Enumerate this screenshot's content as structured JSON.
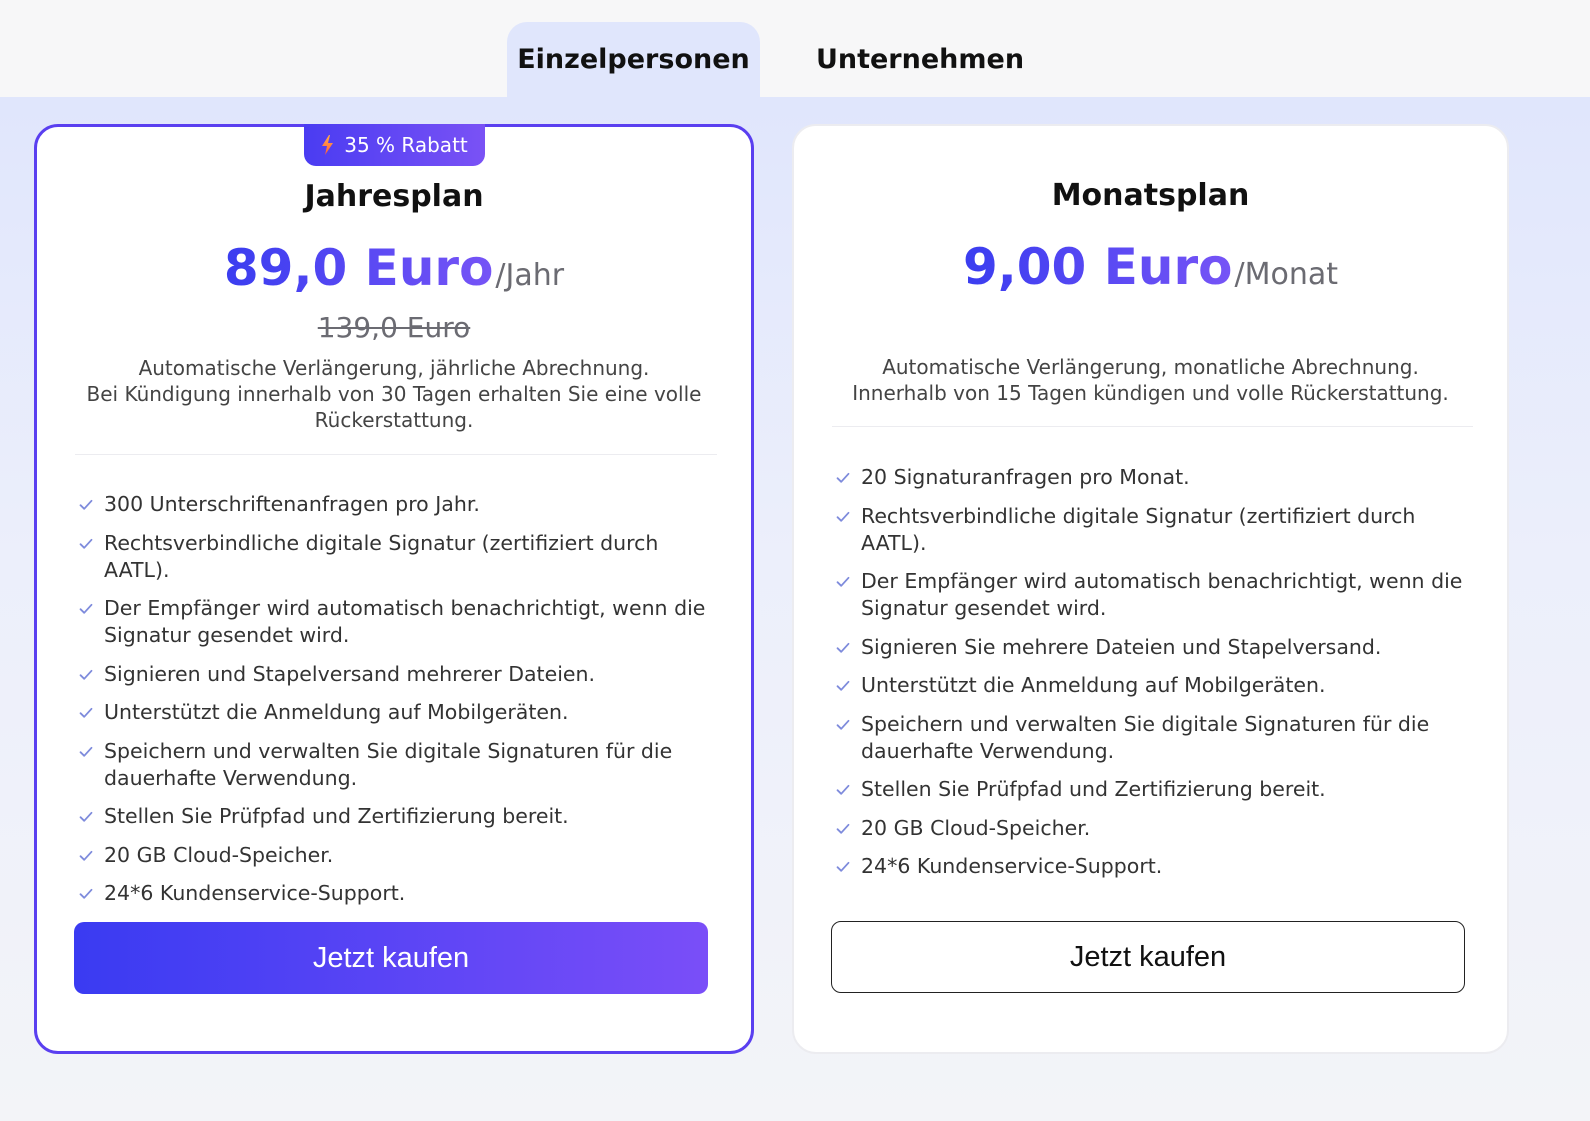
{
  "tabs": [
    {
      "label": "Einzelpersonen",
      "active": true
    },
    {
      "label": "Unternehmen",
      "active": false
    }
  ],
  "colors": {
    "accent_start": "#3a3df0",
    "accent_end": "#7654f6",
    "card_border_active": "#5a3ff0",
    "background_tint": "#e0e6fc"
  },
  "plans": {
    "annual": {
      "badge": {
        "icon": "lightning-bolt-icon",
        "label": "35 % Rabatt"
      },
      "title": "Jahresplan",
      "price": "89,0 Euro",
      "period": "/Jahr",
      "old_price": "139,0 Euro",
      "description": [
        "Automatische Verlängerung, jährliche Abrechnung.",
        "Bei Kündigung innerhalb von 30 Tagen erhalten Sie eine volle Rückerstattung."
      ],
      "features": [
        "300 Unterschriftenanfragen pro Jahr.",
        "Rechtsverbindliche digitale Signatur (zertifiziert durch AATL).",
        "Der Empfänger wird automatisch benachrichtigt, wenn die Signatur gesendet wird.",
        "Signieren und Stapelversand mehrerer Dateien.",
        "Unterstützt die Anmeldung auf Mobilgeräten.",
        "Speichern und verwalten Sie digitale Signaturen für die dauerhafte Verwendung.",
        "Stellen Sie Prüfpfad und Zertifizierung bereit.",
        "20 GB Cloud-Speicher.",
        "24*6 Kundenservice-Support."
      ],
      "button": "Jetzt kaufen"
    },
    "monthly": {
      "title": "Monatsplan",
      "price": "9,00 Euro",
      "period": "/Monat",
      "description": [
        "Automatische Verlängerung, monatliche Abrechnung.",
        "Innerhalb von 15 Tagen kündigen und volle Rückerstattung."
      ],
      "features": [
        "20 Signaturanfragen pro Monat.",
        "Rechtsverbindliche digitale Signatur (zertifiziert durch AATL).",
        "Der Empfänger wird automatisch benachrichtigt, wenn die Signatur gesendet wird.",
        "Signieren Sie mehrere Dateien und Stapelversand.",
        "Unterstützt die Anmeldung auf Mobilgeräten.",
        "Speichern und verwalten Sie digitale Signaturen für die dauerhafte Verwendung.",
        "Stellen Sie Prüfpfad und Zertifizierung bereit.",
        "20 GB Cloud-Speicher.",
        "24*6 Kundenservice-Support."
      ],
      "button": "Jetzt kaufen"
    }
  }
}
